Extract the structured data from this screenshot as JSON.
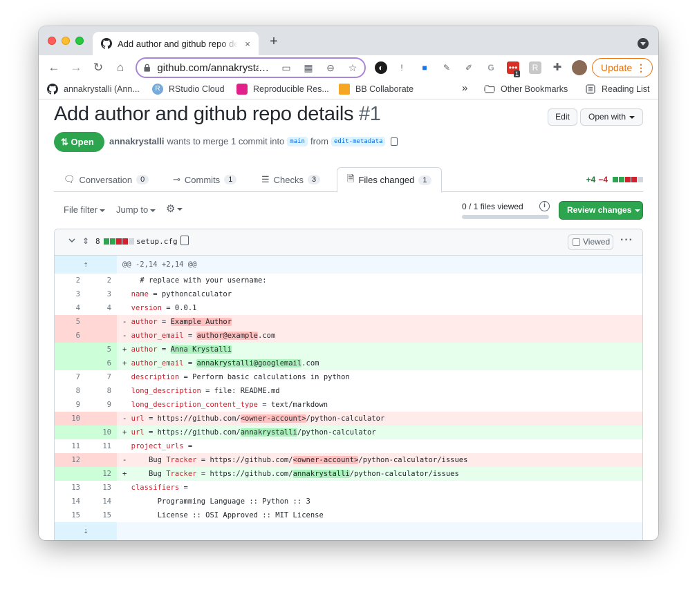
{
  "browser": {
    "tab_title": "Add author and github repo details",
    "tab_close": "×",
    "new_tab": "+",
    "url": "github.com/annakrystalli",
    "update_label": "Update",
    "update_menu": "⋮",
    "extension_badge": "1"
  },
  "bookmarks": {
    "items": [
      {
        "label": "annakrystalli (Ann...",
        "icon": "github-icon"
      },
      {
        "label": "RStudio Cloud",
        "icon": "rstudio-icon",
        "glyph": "R",
        "color": "#75aadb"
      },
      {
        "label": "Reproducible Res...",
        "icon": "hexagon-icon",
        "color": "#e0218a"
      },
      {
        "label": "BB Collaborate",
        "icon": "collaborate-icon",
        "color": "#f5a623"
      }
    ],
    "overflow": "»",
    "other": "Other Bookmarks",
    "reading_list": "Reading List"
  },
  "pr": {
    "title": "Add author and github repo details",
    "number": "#1",
    "edit_label": "Edit",
    "open_with_label": "Open with",
    "state": "Open",
    "author": "annakrystalli",
    "merge_text": "wants to merge 1 commit into",
    "base_branch": "main",
    "from_text": "from",
    "head_branch": "edit-metadata"
  },
  "tabs": [
    {
      "label": "Conversation",
      "count": "0"
    },
    {
      "label": "Commits",
      "count": "1"
    },
    {
      "label": "Checks",
      "count": "3"
    },
    {
      "label": "Files changed",
      "count": "1"
    }
  ],
  "diffstat": {
    "additions": "+4",
    "deletions": "−4"
  },
  "toolbar": {
    "file_filter": "File filter",
    "jump_to": "Jump to",
    "files_viewed": "0 / 1 files viewed",
    "viewed_progress": 0,
    "review_changes": "Review changes"
  },
  "file": {
    "changes": "8",
    "name": "setup.cfg",
    "viewed_label": "Viewed",
    "more": "···"
  },
  "diff": {
    "hunk_header": "@@ -2,14 +2,14 @@",
    "lines": [
      {
        "type": "ctx",
        "old": "2",
        "new": "2",
        "text": "  # replace with your username:"
      },
      {
        "type": "ctx",
        "old": "3",
        "new": "3",
        "key": "name",
        "rest": " = pythoncalculator"
      },
      {
        "type": "ctx",
        "old": "4",
        "new": "4",
        "key": "version",
        "rest": " = 0.0.1"
      },
      {
        "type": "del",
        "old": "5",
        "new": "",
        "key": "author",
        "rest": " = ",
        "hl": "Example Author",
        "tail": ""
      },
      {
        "type": "del",
        "old": "6",
        "new": "",
        "key": "author_email",
        "rest": " = ",
        "hl": "author@example",
        "tail": ".com"
      },
      {
        "type": "add",
        "old": "",
        "new": "5",
        "key": "author",
        "rest": " = ",
        "hl": "Anna Krystalli",
        "tail": ""
      },
      {
        "type": "add",
        "old": "",
        "new": "6",
        "key": "author_email",
        "rest": " = ",
        "hl": "annakrystalli@googlemail",
        "tail": ".com"
      },
      {
        "type": "ctx",
        "old": "7",
        "new": "7",
        "key": "description",
        "rest": " = Perform basic calculations in python"
      },
      {
        "type": "ctx",
        "old": "8",
        "new": "8",
        "key": "long_description",
        "rest": " = file: README.md"
      },
      {
        "type": "ctx",
        "old": "9",
        "new": "9",
        "key": "long_description_content_type",
        "rest": " = text/markdown"
      },
      {
        "type": "del",
        "old": "10",
        "new": "",
        "key": "url",
        "rest": " = https://github.com/",
        "hl": "<owner-account>",
        "tail": "/python-calculator"
      },
      {
        "type": "add",
        "old": "",
        "new": "10",
        "key": "url",
        "rest": " = https://github.com/",
        "hl": "annakrystalli",
        "tail": "/python-calculator"
      },
      {
        "type": "ctx",
        "old": "11",
        "new": "11",
        "key": "project_urls",
        "rest": " ="
      },
      {
        "type": "del",
        "old": "12",
        "new": "",
        "pre": "    Bug ",
        "key": "Tracker",
        "rest": " = https://github.com/",
        "hl": "<owner-account>",
        "tail": "/python-calculator/issues"
      },
      {
        "type": "add",
        "old": "",
        "new": "12",
        "pre": "    Bug ",
        "key": "Tracker",
        "rest": " = https://github.com/",
        "hl": "annakrystalli",
        "tail": "/python-calculator/issues"
      },
      {
        "type": "ctx",
        "old": "13",
        "new": "13",
        "key": "classifiers",
        "rest": " ="
      },
      {
        "type": "ctx",
        "old": "14",
        "new": "14",
        "text": "      Programming Language :: Python :: 3"
      },
      {
        "type": "ctx",
        "old": "15",
        "new": "15",
        "text": "      License :: OSI Approved :: MIT License"
      }
    ]
  }
}
